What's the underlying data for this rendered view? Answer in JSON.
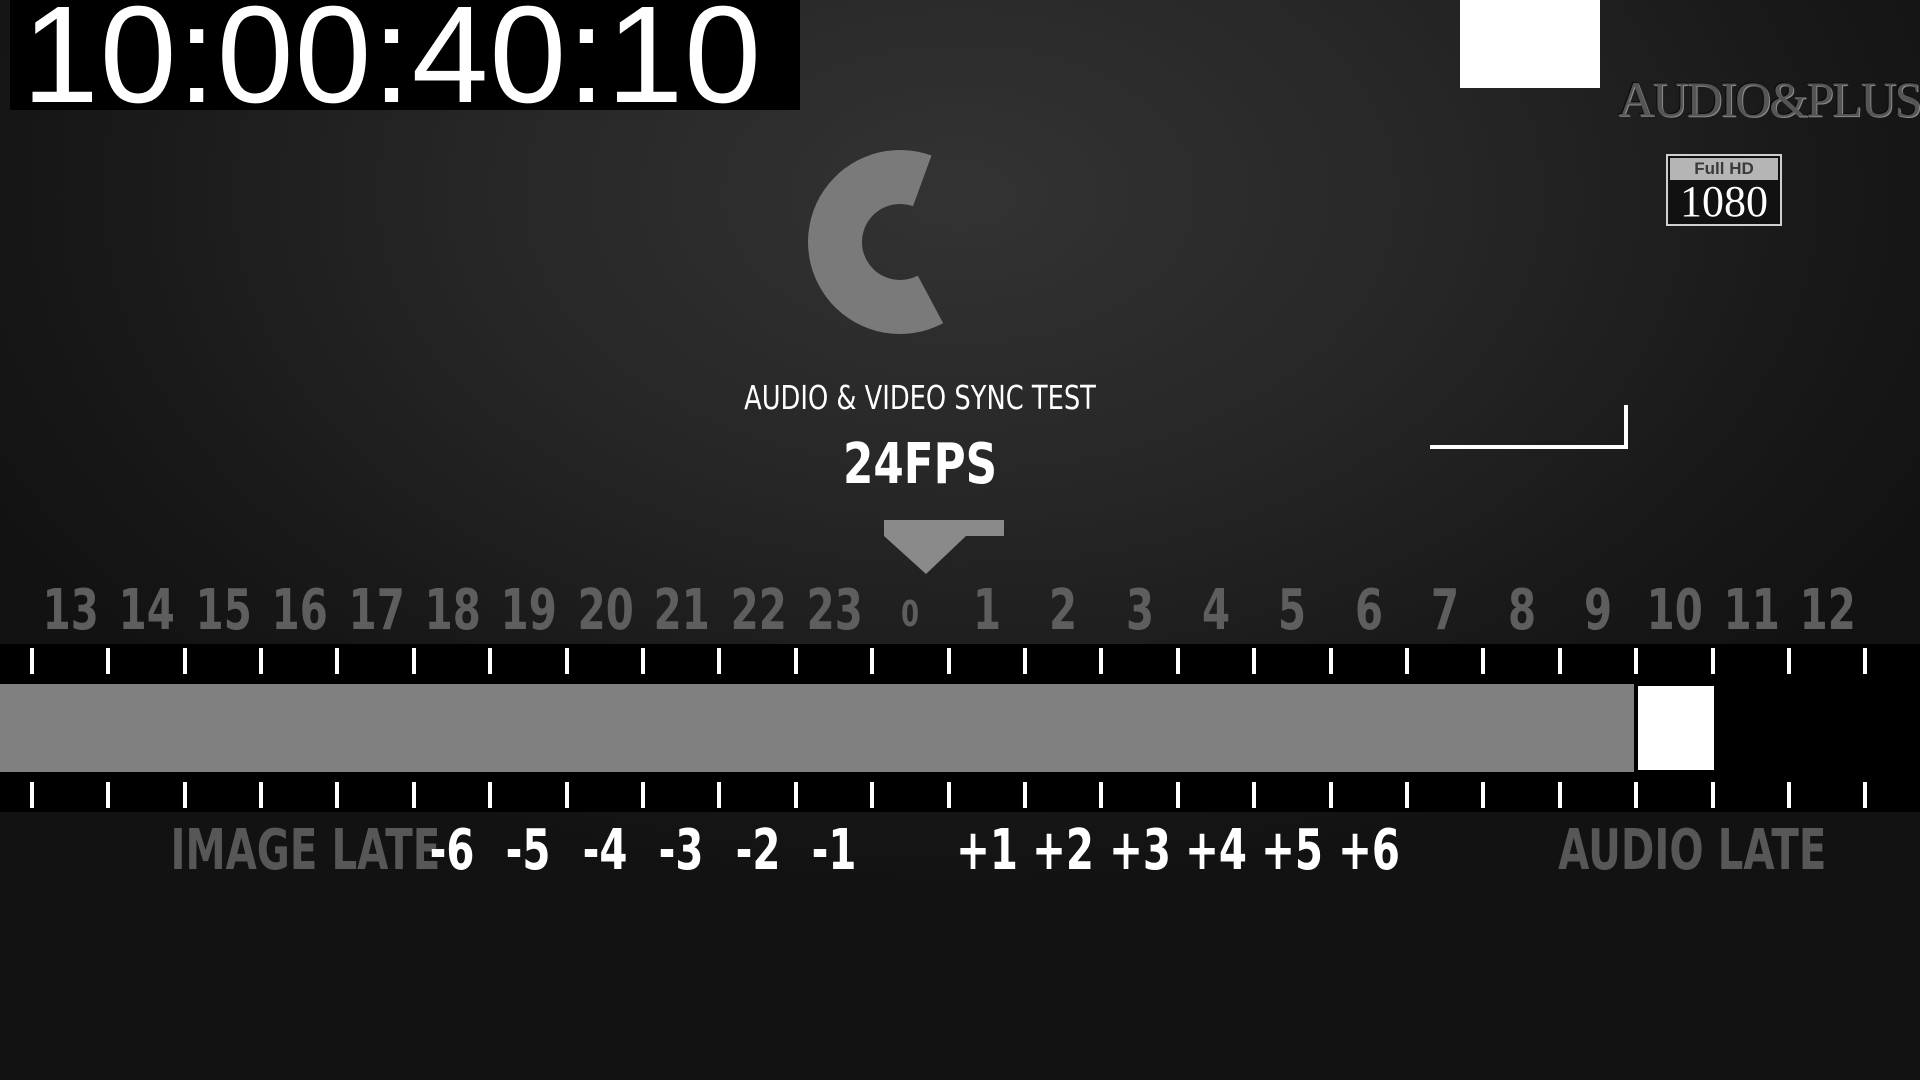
{
  "timecode": "10:00:40:10",
  "logo": {
    "text": "AUDIO&PLUS"
  },
  "badge": {
    "top": "Full HD",
    "bottom": "1080"
  },
  "test": {
    "title": "AUDIO & VIDEO SYNC TEST",
    "fps": "24FPS"
  },
  "frame_labels": [
    "13",
    "14",
    "15",
    "16",
    "17",
    "18",
    "19",
    "20",
    "21",
    "22",
    "23",
    "0",
    "1",
    "2",
    "3",
    "4",
    "5",
    "6",
    "7",
    "8",
    "9",
    "10",
    "11",
    "12"
  ],
  "current_frame": "10",
  "scale": {
    "left_label": "IMAGE LATE",
    "right_label": "AUDIO LATE",
    "negative": [
      "-6",
      "-5",
      "-4",
      "-3",
      "-2",
      "-1"
    ],
    "positive": [
      "+1",
      "+2",
      "+3",
      "+4",
      "+5",
      "+6"
    ]
  },
  "colors": {
    "background": "#1e1e1e",
    "arc": "#7a7a7a",
    "bar_fill": "#808080",
    "cursor": "#ffffff",
    "frame_label": "#5e5e5e",
    "scale_text": "#ffffff"
  },
  "icons": {
    "arc": "progress-arc",
    "pointer": "down-triangle-pointer"
  }
}
